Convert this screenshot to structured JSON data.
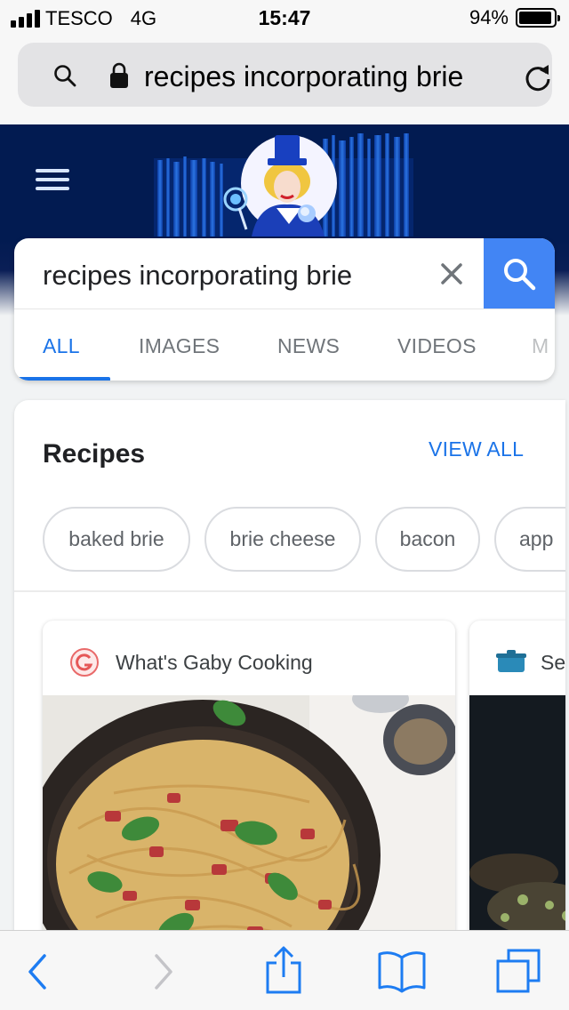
{
  "status_bar": {
    "carrier": "TESCO",
    "network": "4G",
    "time": "15:47",
    "battery_percent": "94%",
    "battery_level": 0.94
  },
  "browser": {
    "address_text": "recipes incorporating brie"
  },
  "search": {
    "query": "recipes incorporating brie",
    "tabs": [
      {
        "label": "ALL",
        "active": true
      },
      {
        "label": "IMAGES",
        "active": false
      },
      {
        "label": "NEWS",
        "active": false
      },
      {
        "label": "VIDEOS",
        "active": false
      },
      {
        "label": "M",
        "active": false
      }
    ]
  },
  "recipes": {
    "title": "Recipes",
    "view_all": "VIEW ALL",
    "chips": [
      "baked brie",
      "brie cheese",
      "bacon",
      "app"
    ],
    "cards": [
      {
        "source": "What's Gaby Cooking",
        "icon": "gaby-logo-icon"
      },
      {
        "source": "Ser",
        "icon": "pot-icon"
      }
    ]
  },
  "colors": {
    "accent": "#1a73e8",
    "search_button": "#4285f4",
    "doodle_background": "#021b51",
    "ios_blue": "#1d7cf2"
  }
}
